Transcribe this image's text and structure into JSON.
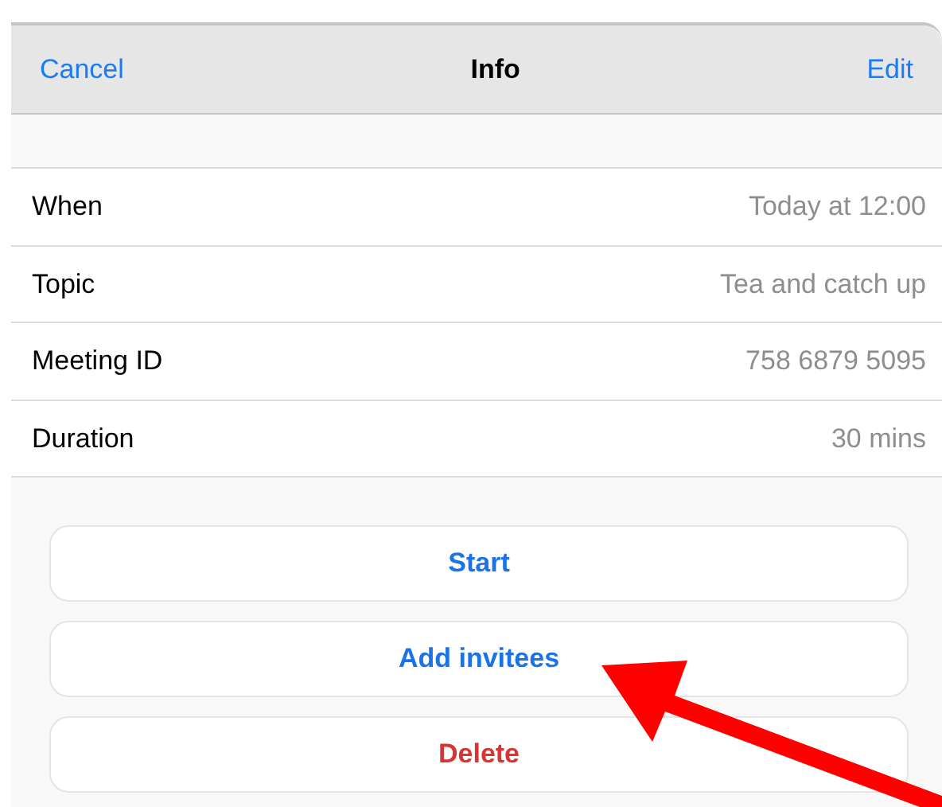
{
  "header": {
    "cancel": "Cancel",
    "title": "Info",
    "edit": "Edit"
  },
  "details": [
    {
      "label": "When",
      "value": "Today at 12:00"
    },
    {
      "label": "Topic",
      "value": "Tea and catch up"
    },
    {
      "label": "Meeting ID",
      "value": "758 6879 5095"
    },
    {
      "label": "Duration",
      "value": "30 mins"
    }
  ],
  "buttons": [
    {
      "label": "Start",
      "kind": "action"
    },
    {
      "label": "Add invitees",
      "kind": "action"
    },
    {
      "label": "Delete",
      "kind": "destructive"
    }
  ]
}
